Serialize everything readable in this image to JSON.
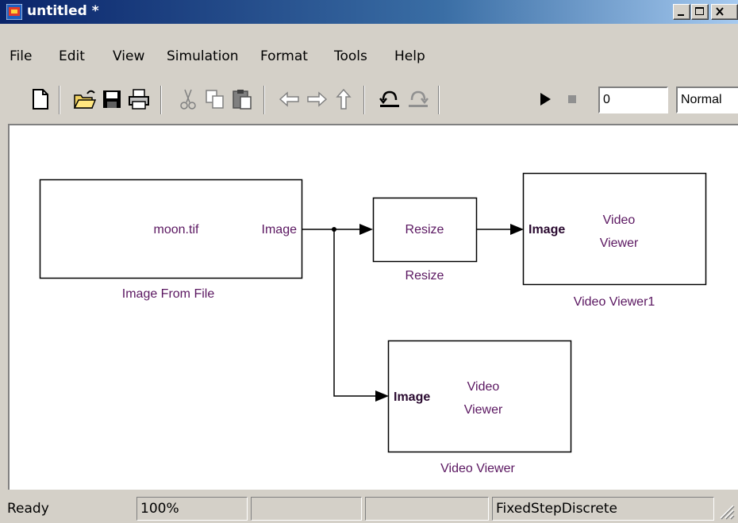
{
  "window": {
    "title": "untitled *"
  },
  "menu": [
    "File",
    "Edit",
    "View",
    "Simulation",
    "Format",
    "Tools",
    "Help"
  ],
  "toolbar": {
    "buttons": [
      "new-model",
      "open",
      "save",
      "print",
      "cut",
      "copy",
      "paste",
      "back",
      "forward",
      "up",
      "undo",
      "redo",
      "start-simulation",
      "stop-simulation"
    ],
    "stop_time": "0",
    "sim_mode": "Normal"
  },
  "diagram": {
    "blocks": {
      "image_from_file": {
        "content": "moon.tif",
        "port_out": "Image",
        "caption": "Image From File"
      },
      "resize": {
        "content": "Resize",
        "caption": "Resize"
      },
      "viewer1": {
        "port_in": "Image",
        "content_line1": "Video",
        "content_line2": "Viewer",
        "caption": "Video Viewer1"
      },
      "viewer": {
        "port_in": "Image",
        "content_line1": "Video",
        "content_line2": "Viewer",
        "caption": "Video Viewer"
      }
    }
  },
  "status": {
    "state": "Ready",
    "zoom": "100%",
    "solver": "FixedStepDiscrete"
  }
}
